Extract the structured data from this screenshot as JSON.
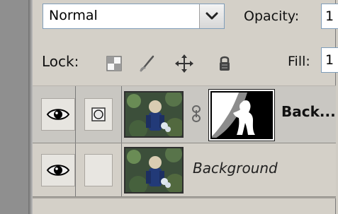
{
  "blend_mode": {
    "value": "Normal",
    "dropdown_icon": "chevron-down-icon"
  },
  "opacity": {
    "label": "Opacity:",
    "value": "1"
  },
  "lock": {
    "label": "Lock:",
    "icons": [
      "lock-transparency-icon",
      "lock-image-icon",
      "lock-position-icon",
      "lock-all-icon"
    ]
  },
  "fill": {
    "label": "Fill:",
    "value": "1"
  },
  "layers": [
    {
      "name": "Back...",
      "visible": true,
      "style": "bold",
      "thumbnail_icon": "person-photo-thumbnail",
      "mask_icon": "layer-mask-thumbnail",
      "link_icon": "chain-link-icon",
      "aux_icon": "circle-mask-icon"
    },
    {
      "name": "Background",
      "visible": true,
      "style": "italic",
      "thumbnail_icon": "person-photo-thumbnail"
    }
  ],
  "colors": {
    "panel_bg": "#d4d0c8",
    "selected_row_bg": "#c9c7c2",
    "input_border": "#7f9db9",
    "dark_gutter": "#8f8f8f"
  }
}
